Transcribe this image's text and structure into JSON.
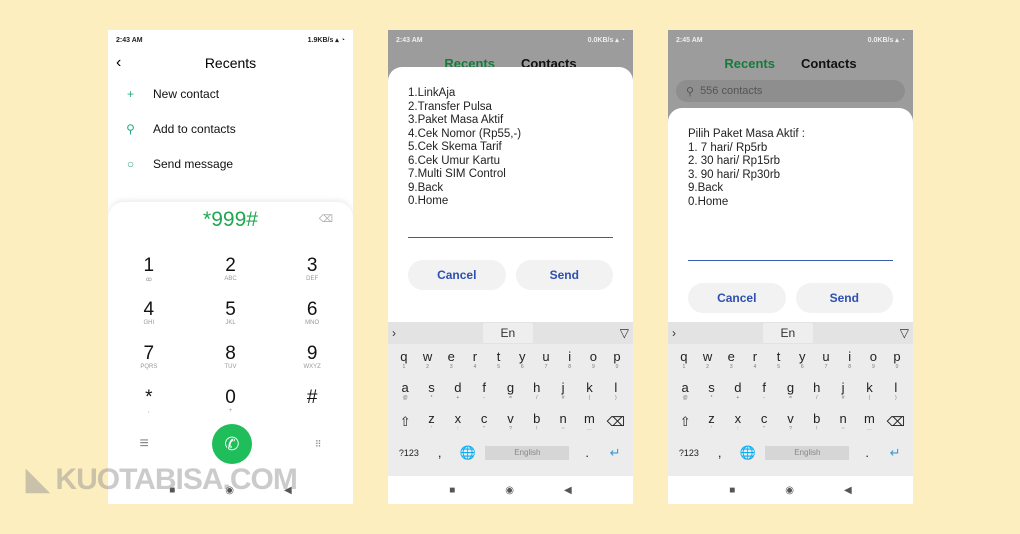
{
  "phone1": {
    "time": "2:43 AM",
    "net": "1.9KB/s",
    "title": "Recents",
    "menu": [
      {
        "icon": "plus-icon",
        "glyph": "+",
        "label": "New contact"
      },
      {
        "icon": "person-icon",
        "glyph": "⚲",
        "label": "Add to contacts"
      },
      {
        "icon": "message-icon",
        "glyph": "○",
        "label": "Send message"
      }
    ],
    "number": "*999#",
    "keys": [
      {
        "d": "1",
        "l": "ꝏ"
      },
      {
        "d": "2",
        "l": "ABC"
      },
      {
        "d": "3",
        "l": "DEF"
      },
      {
        "d": "4",
        "l": "GHI"
      },
      {
        "d": "5",
        "l": "JKL"
      },
      {
        "d": "6",
        "l": "MNO"
      },
      {
        "d": "7",
        "l": "PQRS"
      },
      {
        "d": "8",
        "l": "TUV"
      },
      {
        "d": "9",
        "l": "WXYZ"
      },
      {
        "d": "*",
        "l": ","
      },
      {
        "d": "0",
        "l": "+"
      },
      {
        "d": "#",
        "l": ""
      }
    ]
  },
  "phone2": {
    "time": "2:43 AM",
    "net": "0.0KB/s",
    "tabs": [
      "Recents",
      "Contacts"
    ],
    "ussd": "1.LinkAja\n2.Transfer Pulsa\n3.Paket Masa Aktif\n4.Cek Nomor (Rp55,-)\n5.Cek Skema Tarif\n6.Cek Umur Kartu\n7.Multi SIM Control\n9.Back\n0.Home",
    "input": "",
    "cancel": "Cancel",
    "send": "Send"
  },
  "phone3": {
    "time": "2:45 AM",
    "net": "0.0KB/s",
    "tabs": [
      "Recents",
      "Contacts"
    ],
    "search_placeholder": "556 contacts",
    "ussd": "Pilih Paket Masa Aktif :\n1. 7 hari/ Rp5rb\n2. 30 hari/ Rp15rb\n3. 90 hari/ Rp30rb\n9.Back\n0.Home",
    "input": "",
    "cancel": "Cancel",
    "send": "Send"
  },
  "keyboard": {
    "lang": "En",
    "space": "English",
    "sym": "?123",
    "rows": [
      [
        [
          "q",
          "1"
        ],
        [
          "w",
          "2"
        ],
        [
          "e",
          "3"
        ],
        [
          "r",
          "4"
        ],
        [
          "t",
          "5"
        ],
        [
          "y",
          "6"
        ],
        [
          "u",
          "7"
        ],
        [
          "i",
          "8"
        ],
        [
          "o",
          "9"
        ],
        [
          "p",
          "0"
        ]
      ],
      [
        [
          "a",
          "@"
        ],
        [
          "s",
          "*"
        ],
        [
          "d",
          "+"
        ],
        [
          "f",
          "-"
        ],
        [
          "g",
          "="
        ],
        [
          "h",
          "/"
        ],
        [
          "j",
          "#"
        ],
        [
          "k",
          "("
        ],
        [
          "l",
          ")"
        ]
      ],
      [
        [
          "z",
          "'"
        ],
        [
          "x",
          ":"
        ],
        [
          "c",
          "\""
        ],
        [
          "v",
          "?"
        ],
        [
          "b",
          "!"
        ],
        [
          "n",
          "~"
        ],
        [
          "m",
          "…"
        ]
      ]
    ]
  },
  "watermark": "KUOTABISA.COM"
}
